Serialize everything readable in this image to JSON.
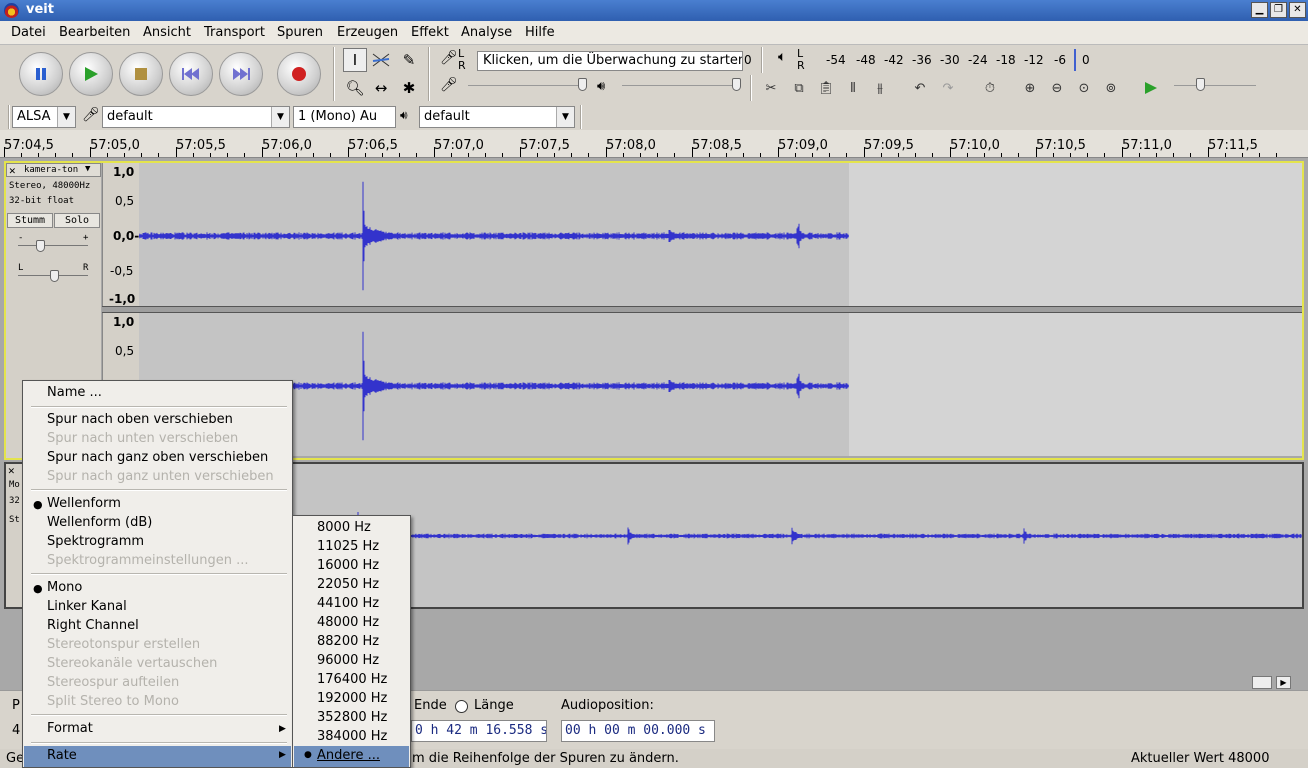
{
  "window": {
    "title": "veit",
    "btn_min": "▁",
    "btn_max": "❐",
    "btn_close": "✕"
  },
  "menubar": [
    {
      "label": "Datei"
    },
    {
      "label": "Bearbeiten"
    },
    {
      "label": "Ansicht"
    },
    {
      "label": "Transport"
    },
    {
      "label": "Spuren"
    },
    {
      "label": "Erzeugen"
    },
    {
      "label": "Effekt"
    },
    {
      "label": "Analyse"
    },
    {
      "label": "Hilfe"
    }
  ],
  "meter": {
    "monitor_prompt": "Klicken, um die Überwachung zu starten",
    "l": "L",
    "r": "R",
    "rec_scale": [
      "0"
    ],
    "play_scale": [
      "-54",
      "-48",
      "-42",
      "-36",
      "-30",
      "-24",
      "-18",
      "-12",
      "-6",
      "0"
    ]
  },
  "device": {
    "host": "ALSA",
    "rec_device": "default",
    "channels": "1 (Mono) Au",
    "play_device": "default"
  },
  "ruler": [
    "57:04,5",
    "57:05,0",
    "57:05,5",
    "57:06,0",
    "57:06,5",
    "57:07,0",
    "57:07,5",
    "57:08,0",
    "57:08,5",
    "57:09,0",
    "57:09,5",
    "57:10,0",
    "57:10,5",
    "57:11,0",
    "57:11,5"
  ],
  "track1": {
    "name": "kamera-ton",
    "close": "✕",
    "format1": "Stereo, 48000Hz",
    "format2": "32-bit float",
    "mute": "Stumm",
    "solo": "Solo",
    "gain_minus": "-",
    "gain_plus": "+",
    "pan_l": "L",
    "pan_r": "R",
    "scale_top": [
      "1,0",
      "0,5",
      "0,0-",
      "-0,5",
      "-1,0"
    ],
    "scale_bottom": [
      "1,0",
      "0,5"
    ]
  },
  "track2": {
    "close": "✕",
    "name_partial": "Mo",
    "format_partial": "32",
    "mute_partial": "St"
  },
  "track_menu": {
    "items": [
      {
        "label": "Name ...",
        "disabled": false,
        "bullet": false
      },
      {
        "label": "Spur nach oben verschieben",
        "disabled": false,
        "bullet": false
      },
      {
        "label": "Spur nach unten verschieben",
        "disabled": true,
        "bullet": false
      },
      {
        "label": "Spur nach ganz oben verschieben",
        "disabled": false,
        "bullet": false
      },
      {
        "label": "Spur nach ganz unten verschieben",
        "disabled": true,
        "bullet": false
      },
      {
        "label": "Wellenform",
        "disabled": false,
        "bullet": true
      },
      {
        "label": "Wellenform (dB)",
        "disabled": false,
        "bullet": false
      },
      {
        "label": "Spektrogramm",
        "disabled": false,
        "bullet": false
      },
      {
        "label": "Spektrogrammeinstellungen ...",
        "disabled": true,
        "bullet": false
      },
      {
        "label": "Mono",
        "disabled": false,
        "bullet": true
      },
      {
        "label": "Linker Kanal",
        "disabled": false,
        "bullet": false
      },
      {
        "label": "Right Channel",
        "disabled": false,
        "bullet": false
      },
      {
        "label": "Stereotonspur erstellen",
        "disabled": true,
        "bullet": false
      },
      {
        "label": "Stereokanäle vertauschen",
        "disabled": true,
        "bullet": false
      },
      {
        "label": "Stereospur aufteilen",
        "disabled": true,
        "bullet": false
      },
      {
        "label": "Split Stereo to Mono",
        "disabled": true,
        "bullet": false
      },
      {
        "label": "Format",
        "disabled": false,
        "bullet": false
      },
      {
        "label": "Rate",
        "disabled": false,
        "bullet": false
      }
    ],
    "submenu_arrow": "▶"
  },
  "rate_menu": {
    "items": [
      "8000 Hz",
      "11025 Hz",
      "16000 Hz",
      "22050 Hz",
      "44100 Hz",
      "48000 Hz",
      "88200 Hz",
      "96000 Hz",
      "176400 Hz",
      "192000 Hz",
      "352800 Hz",
      "384000 Hz",
      "Andere ..."
    ],
    "selected": "Andere ..."
  },
  "selection": {
    "end_label": "Ende",
    "length_label": "Länge",
    "end_value": "0 h 42 m 16.558 s",
    "audio_pos_label": "Audioposition:",
    "audio_pos_value": "00 h 00 m 00.000 s",
    "left_partial_p": "P",
    "left_partial_4": "4"
  },
  "status": {
    "left_partial": "Ge",
    "message": "m die Reihenfolge der Spuren zu ändern.",
    "right": "Aktueller Wert 48000"
  },
  "colors": {
    "wave": "#3333cc",
    "menu_highlight": "#6f8fbd",
    "title": "#3566b8"
  }
}
